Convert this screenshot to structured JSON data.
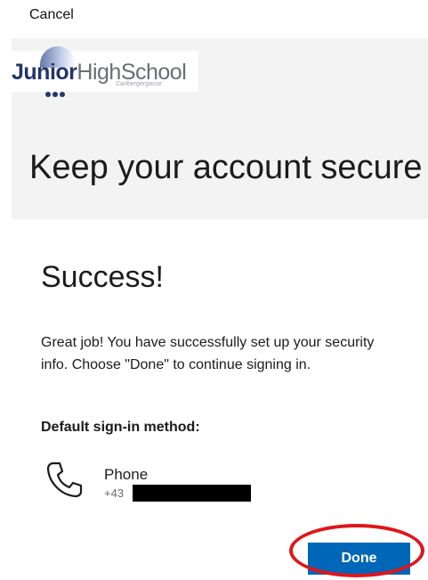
{
  "top_bar": {
    "cancel_label": "Cancel"
  },
  "logo": {
    "bold_text": "Junior",
    "regular_text": "HighSchool",
    "subtitle": "Carlbergergasse"
  },
  "header": {
    "title": "Keep your account secure"
  },
  "content": {
    "heading": "Success!",
    "message": "Great job! You have successfully set up your security info. Choose \"Done\" to continue signing in.",
    "default_method_label": "Default sign-in method:",
    "method": {
      "icon": "phone-icon",
      "name": "Phone",
      "number_prefix": "+43",
      "number_redacted": true
    }
  },
  "actions": {
    "done_label": "Done"
  },
  "colors": {
    "accent": "#0067b8",
    "annotation": "#e0151b",
    "header_band": "#f3f3f3"
  }
}
